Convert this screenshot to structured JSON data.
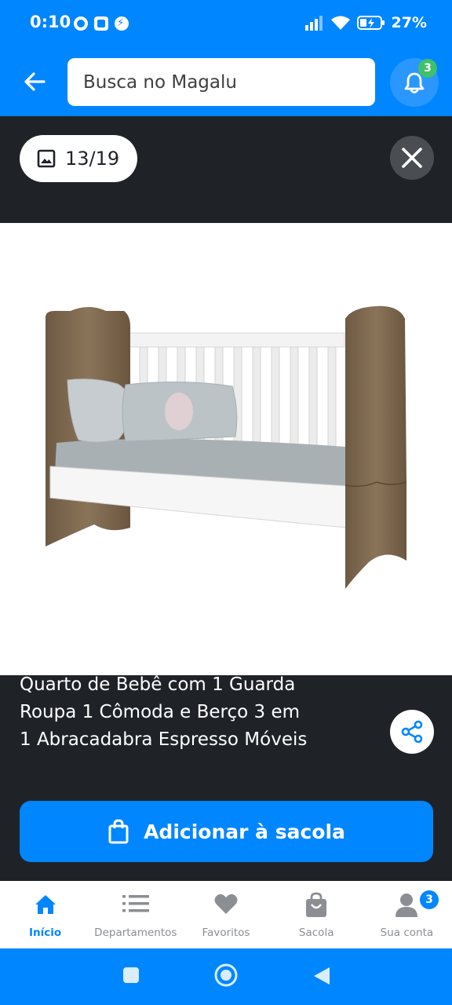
{
  "status_bar": {
    "time": "0:10",
    "battery": "27%"
  },
  "header": {
    "search_placeholder": "Busca no Magalu",
    "notification_count": "3"
  },
  "gallery": {
    "counter": "13/19"
  },
  "product": {
    "title_lines": [
      "Quarto de Bebê com 1 Guarda",
      "Roupa 1 Cômoda e Berço 3 em",
      "1 Abracadabra Espresso Móveis"
    ],
    "add_button": "Adicionar à sacola"
  },
  "bottom_nav": {
    "items": [
      {
        "label": "Início",
        "icon": "home-icon"
      },
      {
        "label": "Departamentos",
        "icon": "list-icon"
      },
      {
        "label": "Favoritos",
        "icon": "heart-icon"
      },
      {
        "label": "Sacola",
        "icon": "bag-icon"
      },
      {
        "label": "Sua conta",
        "icon": "user-icon"
      }
    ],
    "account_badge": "3"
  },
  "colors": {
    "brand_blue": "#0086ff",
    "dark_bg": "#1f2328",
    "green_badge": "#3fc06a"
  }
}
